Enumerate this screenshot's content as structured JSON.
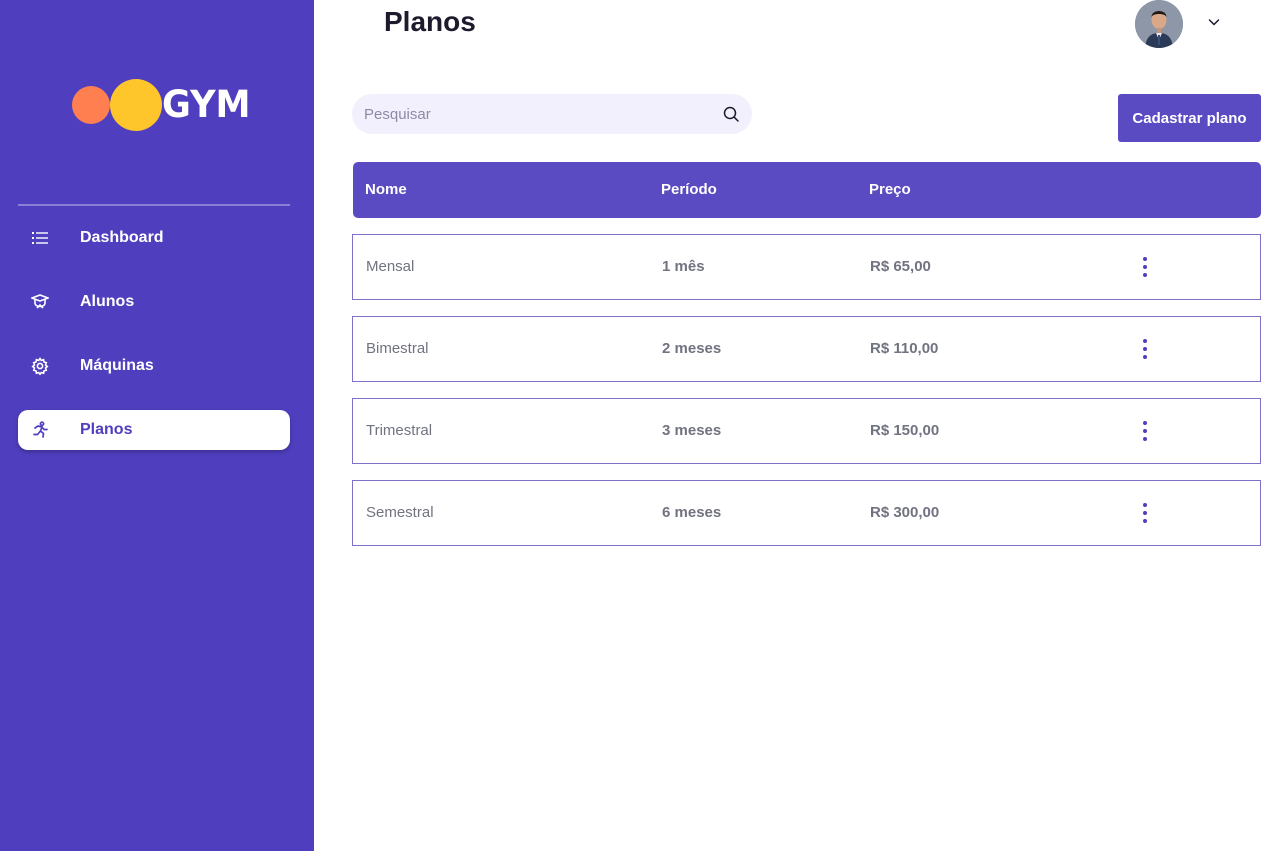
{
  "brand": {
    "logo_text": "GYM",
    "colors": {
      "sidebar": "#4f3fbf",
      "circle1": "#ff7f50",
      "circle2": "#ffc62b",
      "accent": "#5a4bc2"
    }
  },
  "sidebar": {
    "items": [
      {
        "label": "Dashboard",
        "icon": "list-icon"
      },
      {
        "label": "Alunos",
        "icon": "student-icon"
      },
      {
        "label": "Máquinas",
        "icon": "gear-icon"
      },
      {
        "label": "Planos",
        "icon": "running-icon",
        "active": true
      }
    ]
  },
  "header": {
    "title": "Planos",
    "user_avatar": "avatar"
  },
  "toolbar": {
    "search_placeholder": "Pesquisar",
    "add_label": "Cadastrar plano"
  },
  "table": {
    "columns": [
      "Nome",
      "Período",
      "Preço"
    ],
    "rows": [
      {
        "nome": "Mensal",
        "periodo": "1 mês",
        "preco": "R$ 65,00"
      },
      {
        "nome": "Bimestral",
        "periodo": "2 meses",
        "preco": "R$ 110,00"
      },
      {
        "nome": "Trimestral",
        "periodo": "3 meses",
        "preco": "R$ 150,00"
      },
      {
        "nome": "Semestral",
        "periodo": "6 meses",
        "preco": "R$ 300,00"
      }
    ]
  }
}
